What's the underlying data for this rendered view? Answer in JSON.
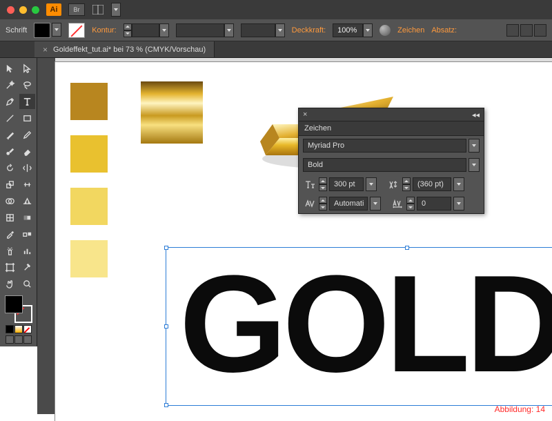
{
  "titlebar": {
    "ai": "Ai",
    "br": "Br"
  },
  "controlbar": {
    "schrift": "Schrift",
    "kontur": "Kontur:",
    "deckkraft": "Deckkraft:",
    "deckkraft_val": "100%",
    "zeichen": "Zeichen",
    "absatz": "Absatz:"
  },
  "doc_tab": {
    "label": "Goldeffekt_tut.ai* bei 73 % (CMYK/Vorschau)",
    "close": "×"
  },
  "canvas": {
    "swatches": [
      "#b8861f",
      "#e9c12f",
      "#f2d760",
      "#f8e58b"
    ],
    "text": "GOLD",
    "caption": "Abbildung: 14"
  },
  "char_panel": {
    "close": "×",
    "expand": "◂◂",
    "tab": "Zeichen",
    "font": "Myriad Pro",
    "style": "Bold",
    "size": "300 pt",
    "leading": "(360 pt)",
    "kerning": "Automati",
    "tracking": "0"
  }
}
